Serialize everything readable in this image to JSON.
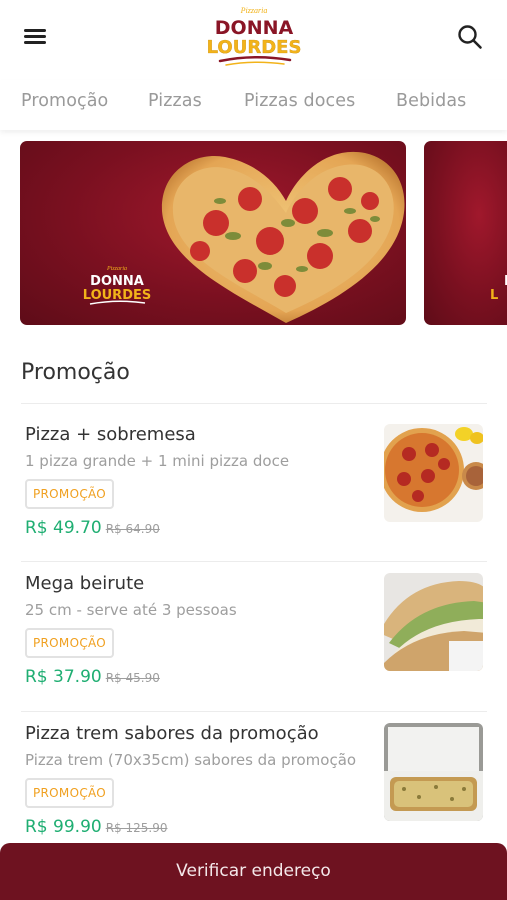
{
  "header": {
    "logo_top": "Pizzaria",
    "logo_line1": "DONNA",
    "logo_line2": "LOURDES"
  },
  "tabs": [
    {
      "label": "Promoção"
    },
    {
      "label": "Pizzas"
    },
    {
      "label": "Pizzas doces"
    },
    {
      "label": "Bebidas"
    }
  ],
  "banner": {
    "logo_top": "Pizzaria",
    "logo_line1": "DONNA",
    "logo_line2": "LOURDES"
  },
  "section": {
    "title": "Promoção"
  },
  "products": [
    {
      "name": "Pizza + sobremesa",
      "description": "1 pizza grande + 1 mini pizza doce",
      "badge": "PROMOÇÃO",
      "price": "R$ 49.70",
      "old_price": "R$ 64.90"
    },
    {
      "name": "Mega beirute",
      "description": "25 cm - serve até 3 pessoas",
      "badge": "PROMOÇÃO",
      "price": "R$ 37.90",
      "old_price": "R$ 45.90"
    },
    {
      "name": "Pizza trem sabores da promoção",
      "description": "Pizza trem (70x35cm) sabores da promoção",
      "badge": "PROMOÇÃO",
      "price": "R$ 99.90",
      "old_price": "R$ 125.90"
    }
  ],
  "bottom_bar": {
    "label": "Verificar endereço"
  },
  "colors": {
    "brand_dark_red": "#6e1220",
    "banner_red": "#7a1020",
    "price_green": "#1fae72",
    "badge_orange": "#f0a020",
    "logo_yellow": "#f2b31a"
  }
}
